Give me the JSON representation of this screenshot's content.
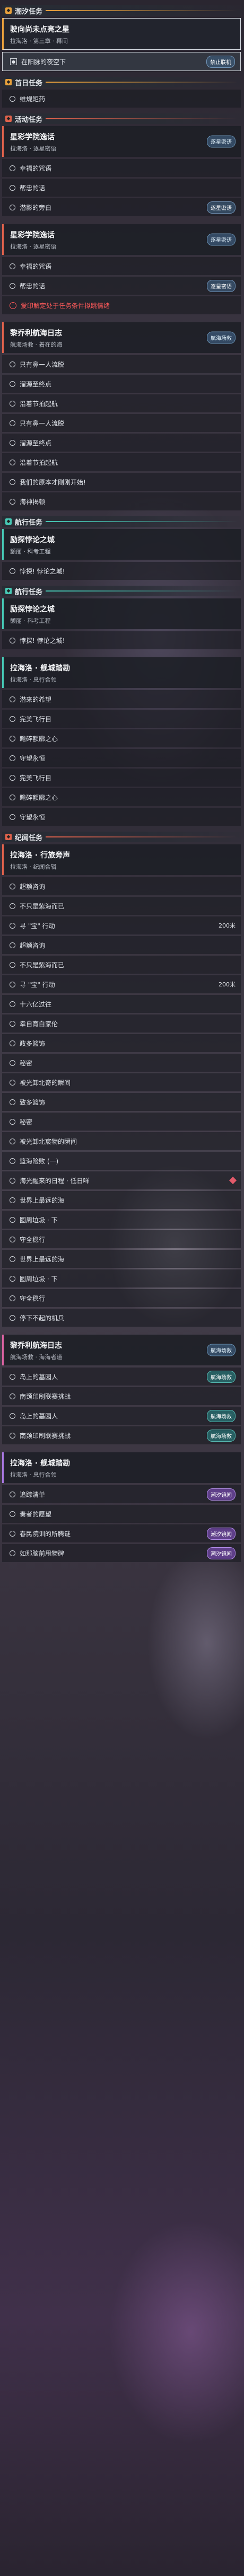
{
  "sections": [
    {
      "key": "huanxi",
      "color": "orange",
      "title": "潮汐任务",
      "cards": [
        {
          "title": "驶向尚未点亮之星",
          "sub": "拉海洛 · 第三章 · 幕间",
          "selected": true,
          "rows": [
            {
              "label": "在阳脉的夜空下",
              "selected": true,
              "pill": "禁止联机",
              "pill_style": "blue"
            }
          ]
        }
      ]
    },
    {
      "key": "fengshou",
      "color": "orange",
      "title": "首日任务",
      "cards": [
        {
          "title": "",
          "sub": "",
          "rows": [
            {
              "label": "维规矩药"
            }
          ]
        }
      ]
    },
    {
      "key": "huodong",
      "color": "red",
      "title": "活动任务",
      "cards": [
        {
          "title": "星彩学院逸话",
          "sub": "拉海洛 · 逐星密语",
          "rows": [
            {
              "label": "幸福的咒语"
            },
            {
              "label": "帮忠的话"
            },
            {
              "label": "潜影的旁白",
              "pill": "逐星密语",
              "pill_style": "blue"
            }
          ],
          "tag": "逐星密语"
        },
        {
          "title": "星彩学院逸话",
          "sub": "拉海洛 · 逐星密语",
          "rows": [
            {
              "label": "幸福的咒语"
            },
            {
              "label": "帮忠的话",
              "pill": "逐星密语",
              "pill_style": "blue"
            },
            {
              "label": "爱印解定处于任务条件拟跳情绪",
              "red": true
            }
          ],
          "tag": "逐星密语"
        },
        {
          "title": "黎乔利航海日志",
          "sub": "航海场救 · 着在的海",
          "rows": [
            {
              "label": "只有鼻一人流脱"
            },
            {
              "label": "溜源至终点"
            },
            {
              "label": "沿着节拍起航"
            },
            {
              "label": "只有鼻一人流脱"
            },
            {
              "label": "溜源至终点"
            },
            {
              "label": "沿着节拍起航"
            },
            {
              "label": "我们的原本才刚刚开始!"
            },
            {
              "label": "海神揭顿"
            }
          ],
          "tag": "航海场救"
        }
      ]
    },
    {
      "key": "bohang1",
      "color": "teal",
      "title": "航行任务",
      "cards": [
        {
          "title": "励探悖论之城",
          "sub": "颤丽 · 科考工程",
          "rows": [
            {
              "label": "悖探! 悖论之城!"
            }
          ]
        }
      ]
    },
    {
      "key": "bohang2",
      "color": "teal",
      "title": "航行任务",
      "cards": [
        {
          "title": "励探悖论之城",
          "sub": "颤丽 · 科考工程",
          "rows": [
            {
              "label": "悖探! 悖论之城!"
            }
          ]
        },
        {
          "title": "拉海洛 · 舰城踏勘",
          "sub": "拉海洛 · 息行合领",
          "rows": [
            {
              "label": "潜来的希望"
            },
            {
              "label": "完美飞行目"
            },
            {
              "label": "瞻碎额廓之心"
            },
            {
              "label": "守望永恒"
            },
            {
              "label": "完美飞行目"
            },
            {
              "label": "瞻碎额廓之心"
            },
            {
              "label": "守望永恒"
            }
          ]
        }
      ]
    },
    {
      "key": "jiyuan",
      "color": "red",
      "title": "纪闻任务",
      "cards": [
        {
          "title": "拉海洛 · 行旅旁声",
          "sub": "拉海洛 · 纪闻合辑",
          "rows": [
            {
              "label": "超额咨询"
            },
            {
              "label": "不只是紫海而已"
            },
            {
              "label": "寻 \"宝\" 行动",
              "right": "200米"
            },
            {
              "label": "超额咨询"
            },
            {
              "label": "不只是紫海而已"
            },
            {
              "label": "寻 \"宝\" 行动",
              "right": "200米"
            },
            {
              "label": "十六亿过往"
            },
            {
              "label": "幸自育白家伦"
            },
            {
              "label": "政多篮饰"
            },
            {
              "label": "秘密"
            },
            {
              "label": "被光卸北奇的瞬间"
            },
            {
              "label": "致多篮饰"
            },
            {
              "label": "秘密"
            },
            {
              "label": "被光卸北宸物的瞬间"
            },
            {
              "label": "篮海险败 (一)"
            },
            {
              "label": "海光醒来的日程 · 低日咩",
              "diamond": true
            },
            {
              "label": "世界上最远的海"
            },
            {
              "label": "圆周垃圾 · 下"
            },
            {
              "label": "守全稳行"
            },
            {
              "label": "世界上最远的海"
            },
            {
              "label": "圆周垃圾 · 下"
            },
            {
              "label": "守全稳行"
            },
            {
              "label": "停下不起的机兵"
            }
          ]
        }
      ]
    },
    {
      "key": "hanghai",
      "color": "pink",
      "title": "",
      "cards": [
        {
          "title": "黎乔利航海日志",
          "sub": "航海场救 · 海海者道",
          "rows": [
            {
              "label": "岛上的墓园人",
              "pill": "航海场救",
              "pill_style": "teal"
            },
            {
              "label": "南颈印刷联赛挑战"
            },
            {
              "label": "岛上的墓园人",
              "pill": "航海场救",
              "pill_style": "teal"
            },
            {
              "label": "南颈印刷联赛挑战",
              "pill": "航海场救",
              "pill_style": "teal"
            }
          ],
          "tag": "航海场救"
        }
      ]
    },
    {
      "key": "last",
      "color": "purple",
      "title": "",
      "cards": [
        {
          "title": "拉海洛 · 舰城踏勘",
          "sub": "拉海洛 · 息行合领",
          "rows": [
            {
              "label": "追踪清单",
              "pill": "潮汐镜闻",
              "pill_style": "purple"
            },
            {
              "label": "奏者的愿望"
            },
            {
              "label": "春民院训的所腾谜",
              "pill": "潮汐镜闻",
              "pill_style": "purple"
            },
            {
              "label": "如那脑前甩物碑",
              "pill": "潮汐镜闻",
              "pill_style": "purple"
            }
          ]
        }
      ]
    }
  ]
}
